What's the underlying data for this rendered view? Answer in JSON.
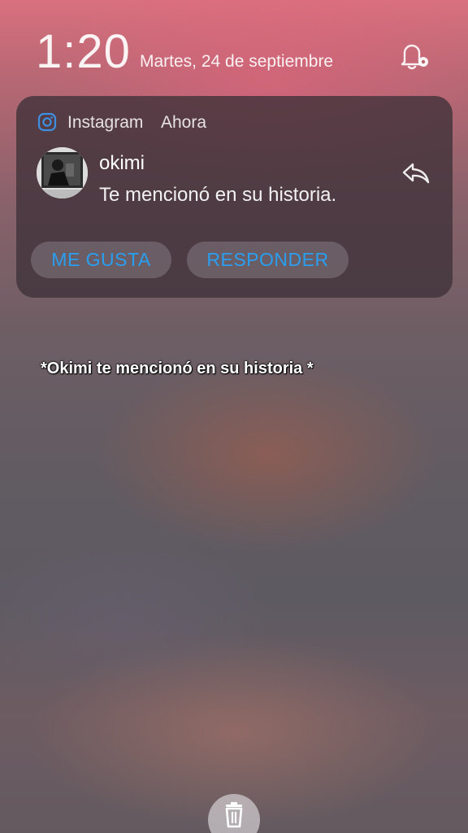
{
  "status": {
    "time": "1:20",
    "date": "Martes, 24 de septiembre"
  },
  "notification": {
    "app_name": "Instagram",
    "received": "Ahora",
    "sender": "okimi",
    "message": "Te mencionó en su historia.",
    "actions": {
      "like_label": "ME GUSTA",
      "reply_label": "RESPONDER"
    },
    "accent_color": "#2a9ff0"
  },
  "caption": "*Okimi te mencionó en su historia *",
  "icons": {
    "notification_settings": "bell-settings-icon",
    "app": "instagram-icon",
    "reply": "reply-arrow-icon",
    "clear_all": "trash-icon"
  }
}
